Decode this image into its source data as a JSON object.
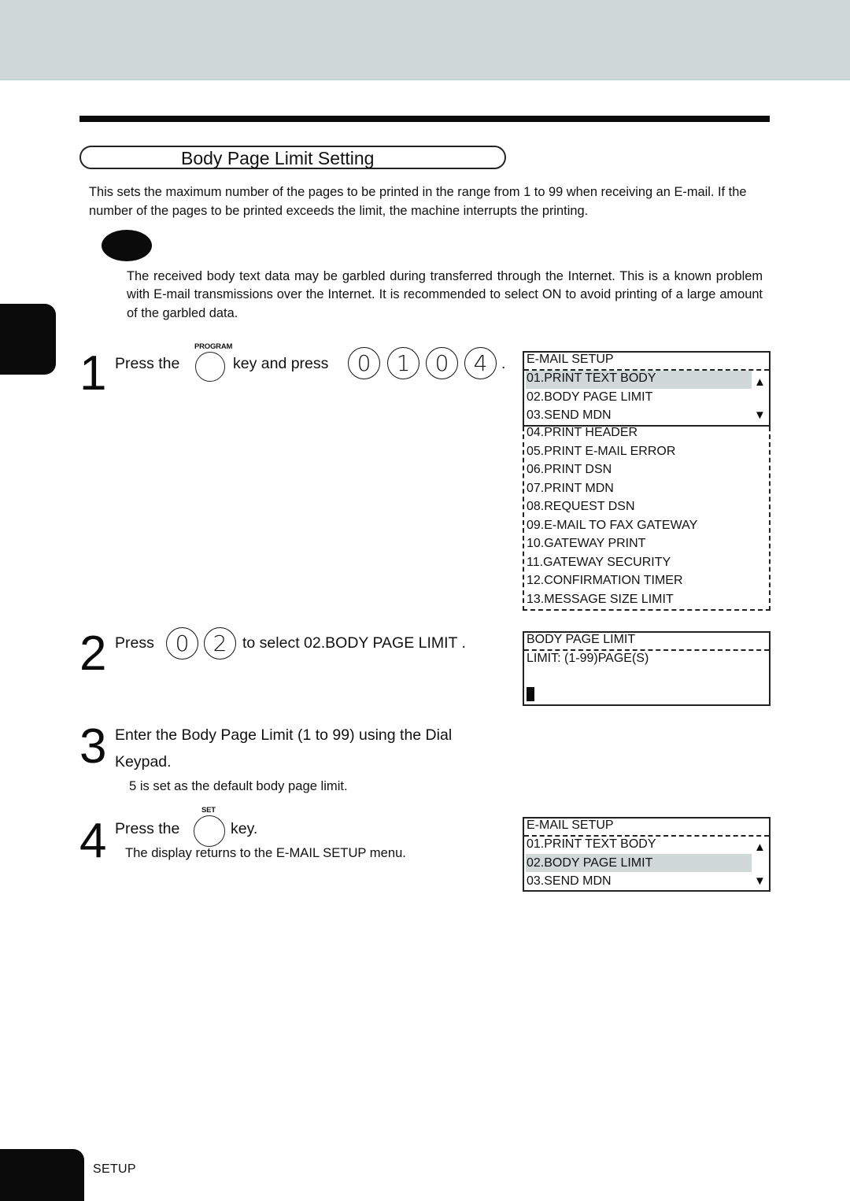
{
  "page": {
    "section_title": "Body Page Limit Setting",
    "intro": "This sets the maximum number of the pages to be printed in the range from 1 to 99 when receiving an E-mail.  If the number of the pages to be printed exceeds the limit, the machine interrupts the printing.",
    "note_text": "The received body text data may be garbled during transferred through the Internet.  This is a known problem with E-mail transmissions over the Internet.  It is recommended to select ON to avoid printing of a  large amount of the garbled data.",
    "footer_label": "SETUP",
    "colors": {
      "header_band": "#d0d9d7",
      "highlight": "#d0d9d7",
      "ink": "#0b0b0b"
    }
  },
  "steps": [
    {
      "number": "1",
      "text_before": "Press the",
      "key_label": "PROGRAM",
      "text_after": "key and press",
      "digits": [
        "0",
        "1",
        "0",
        "4"
      ],
      "trailing": "."
    },
    {
      "number": "2",
      "text_before": "Press",
      "digits": [
        "0",
        "2"
      ],
      "text_after": "to select  02.BODY PAGE LIMIT ."
    },
    {
      "number": "3",
      "line1": "Enter the Body Page Limit (1 to 99) using the Dial",
      "line2": "Keypad.",
      "sub": "5  is set as the default body page limit."
    },
    {
      "number": "4",
      "text_before": "Press the",
      "key_label": "SET",
      "text_after": "key.",
      "sub": "The display returns to the E-MAIL SETUP menu."
    }
  ],
  "lcd1": {
    "title": "E-MAIL SETUP",
    "visible_items": [
      "01.PRINT TEXT BODY",
      "02.BODY PAGE LIMIT",
      "03.SEND MDN"
    ],
    "highlighted_index": 0,
    "scroll_up": "▲",
    "scroll_down": "▼",
    "more_items": [
      "04.PRINT HEADER",
      "05.PRINT E-MAIL ERROR",
      "06.PRINT DSN",
      "07.PRINT MDN",
      "08.REQUEST DSN",
      "09.E-MAIL TO FAX GATEWAY",
      "10.GATEWAY PRINT",
      "11.GATEWAY SECURITY",
      "12.CONFIRMATION TIMER",
      "13.MESSAGE SIZE LIMIT"
    ]
  },
  "lcd2": {
    "title": "BODY PAGE LIMIT",
    "prompt": "LIMIT: (1-99)PAGE(S)"
  },
  "lcd3": {
    "title": "E-MAIL SETUP",
    "visible_items": [
      "01.PRINT TEXT BODY",
      "02.BODY PAGE LIMIT",
      "03.SEND MDN"
    ],
    "highlighted_index": 1,
    "scroll_up": "▲",
    "scroll_down": "▼"
  }
}
